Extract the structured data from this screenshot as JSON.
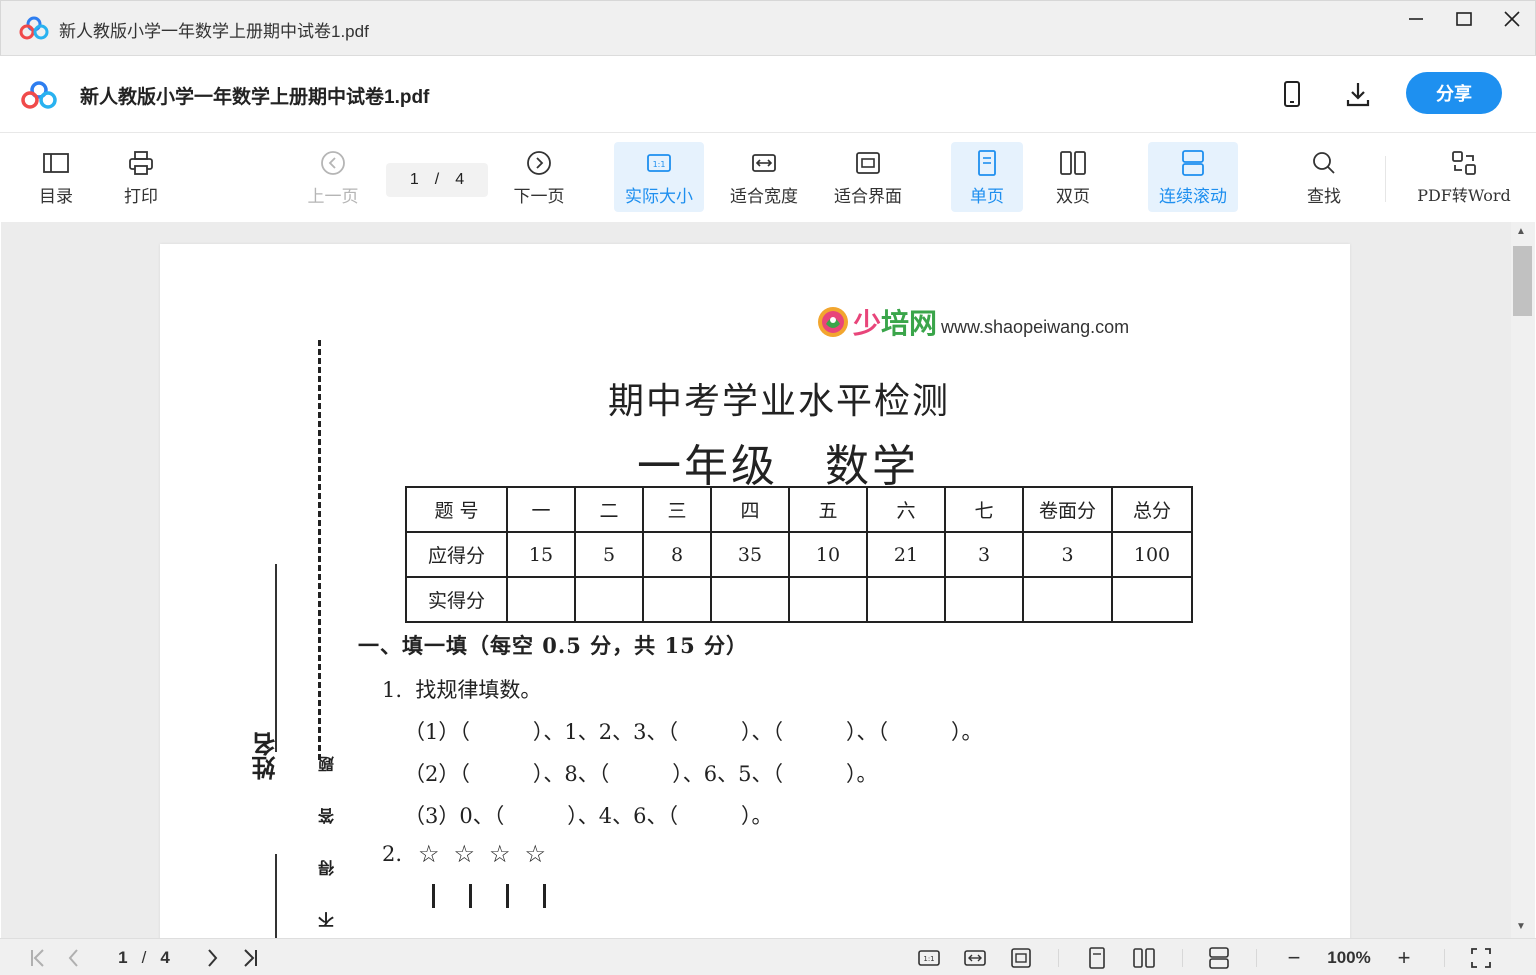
{
  "window": {
    "title": "新人教版小学一年数学上册期中试卷1.pdf"
  },
  "header": {
    "filename": "新人教版小学一年数学上册期中试卷1.pdf",
    "share_label": "分享"
  },
  "toolbar": {
    "toc": "目录",
    "print": "打印",
    "prev": "上一页",
    "current_page": "1",
    "separator": "/",
    "total_pages": "4",
    "next": "下一页",
    "actual_size": "实际大小",
    "fit_width": "适合宽度",
    "fit_page": "适合界面",
    "single_page": "单页",
    "double_page": "双页",
    "continuous_scroll": "连续滚动",
    "search": "查找",
    "pdf_to_word": "PDF转Word"
  },
  "document": {
    "brand_name_a": "少",
    "brand_name_b": "培网",
    "brand_url": "www.shaopeiwang.com",
    "title": "期中考学业水平检测",
    "subtitle": "一年级　数学",
    "table": {
      "headers": [
        "题 号",
        "一",
        "二",
        "三",
        "四",
        "五",
        "六",
        "七",
        "卷面分",
        "总分"
      ],
      "row_expected_label": "应得分",
      "row_expected": [
        "15",
        "5",
        "8",
        "35",
        "10",
        "21",
        "3",
        "3",
        "100"
      ],
      "row_actual_label": "实得分"
    },
    "section1": "一、填一填（每空 0.5 分，共 15 分）",
    "q1": "1.  找规律填数。",
    "q1_1": "（1）（　　　）、1、2、3、（　　　）、（　　　）、（　　　）。",
    "q1_2": "（2）（　　　）、8、（　　　）、6、5、（　　　）。",
    "q1_3": "（3）0、（　　　）、4、6、（　　　）。",
    "q2": "2.",
    "q2_stars": "☆☆☆☆",
    "side_name": "姓名",
    "side_text_1": "题",
    "side_text_2": "答",
    "side_text_3": "得",
    "side_text_4": "不"
  },
  "statusbar": {
    "current_page": "1",
    "separator": "/",
    "total_pages": "4",
    "zoom": "100%",
    "zoom_out": "−",
    "zoom_in": "+"
  },
  "colors": {
    "accent": "#1e8fef",
    "active_bg": "#e6f2fd",
    "share_bg": "#1e90f0"
  }
}
